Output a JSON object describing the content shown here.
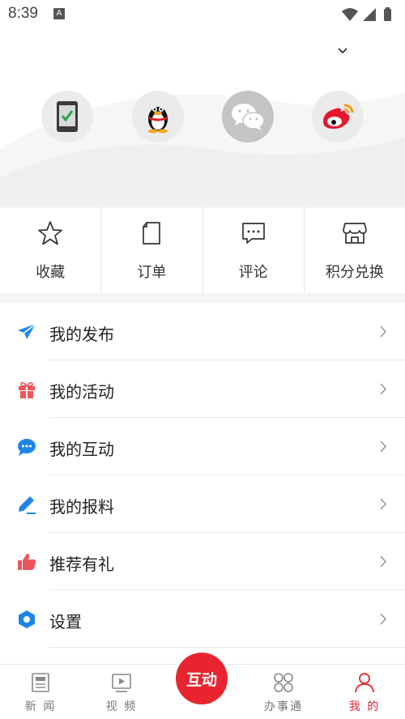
{
  "status_bar": {
    "time": "8:39",
    "notification_badge": "A"
  },
  "login": {
    "options": [
      {
        "name": "phone-login",
        "icon": "phone-check-icon"
      },
      {
        "name": "qq-login",
        "icon": "qq-penguin-icon"
      },
      {
        "name": "wechat-login",
        "icon": "wechat-icon"
      },
      {
        "name": "weibo-login",
        "icon": "weibo-icon"
      }
    ]
  },
  "quick_actions": [
    {
      "label": "收藏",
      "icon": "star-icon"
    },
    {
      "label": "订单",
      "icon": "document-icon"
    },
    {
      "label": "评论",
      "icon": "comment-icon"
    },
    {
      "label": "积分兑换",
      "icon": "store-icon"
    }
  ],
  "menu": [
    {
      "label": "我的发布",
      "icon": "paper-plane-icon",
      "color": "#1f86e8"
    },
    {
      "label": "我的活动",
      "icon": "gift-icon",
      "color": "#f0545a"
    },
    {
      "label": "我的互动",
      "icon": "chat-bubble-icon",
      "color": "#1f86e8"
    },
    {
      "label": "我的报料",
      "icon": "pencil-icon",
      "color": "#1f86e8"
    },
    {
      "label": "推荐有礼",
      "icon": "thumbs-up-icon",
      "color": "#f0545a"
    },
    {
      "label": "设置",
      "icon": "settings-hexagon-icon",
      "color": "#1f86e8"
    }
  ],
  "tab_bar": {
    "tabs": [
      {
        "label": "新 闻",
        "icon": "newspaper-icon",
        "active": false
      },
      {
        "label": "视 频",
        "icon": "video-icon",
        "active": false
      },
      {
        "label": "办事通",
        "icon": "grid-icon",
        "active": false
      },
      {
        "label": "我 的",
        "icon": "person-icon",
        "active": true
      }
    ],
    "center_label": "互动"
  },
  "colors": {
    "accent": "#e8252e",
    "menu_blue": "#1f86e8",
    "menu_red": "#f0545a"
  }
}
